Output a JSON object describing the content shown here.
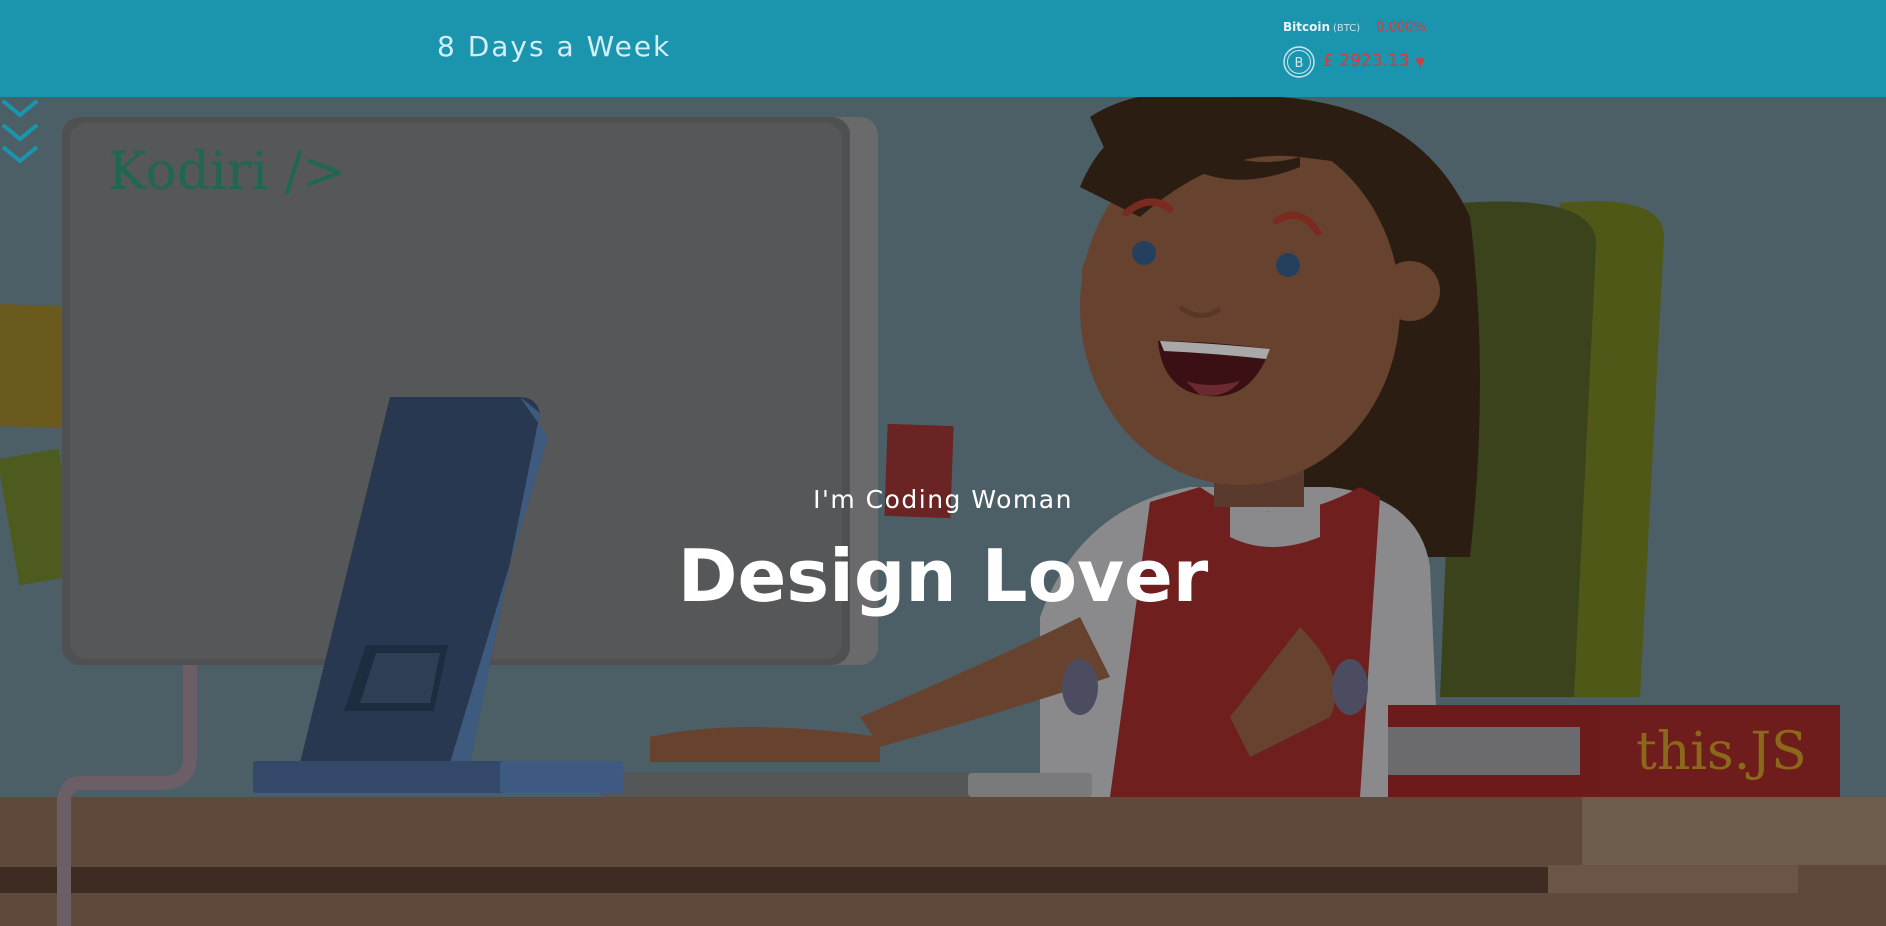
{
  "header": {
    "site_title": "8 Days a Week",
    "background": "#1b95ae"
  },
  "ticker": {
    "coin_name": "Bitcoin",
    "coin_symbol": "(BTC)",
    "change": "0.000%",
    "price": "£ 2923.13",
    "trend": "down",
    "trend_color": "#d73a3a",
    "icon": "bitcoin-icon"
  },
  "hero": {
    "subtitle": "I'm Coding Woman",
    "title": "Design Lover",
    "monitor_logo": "Kodiri />",
    "book_label": "this.JS",
    "scroll_icon": "triple-chevron-down-icon"
  }
}
